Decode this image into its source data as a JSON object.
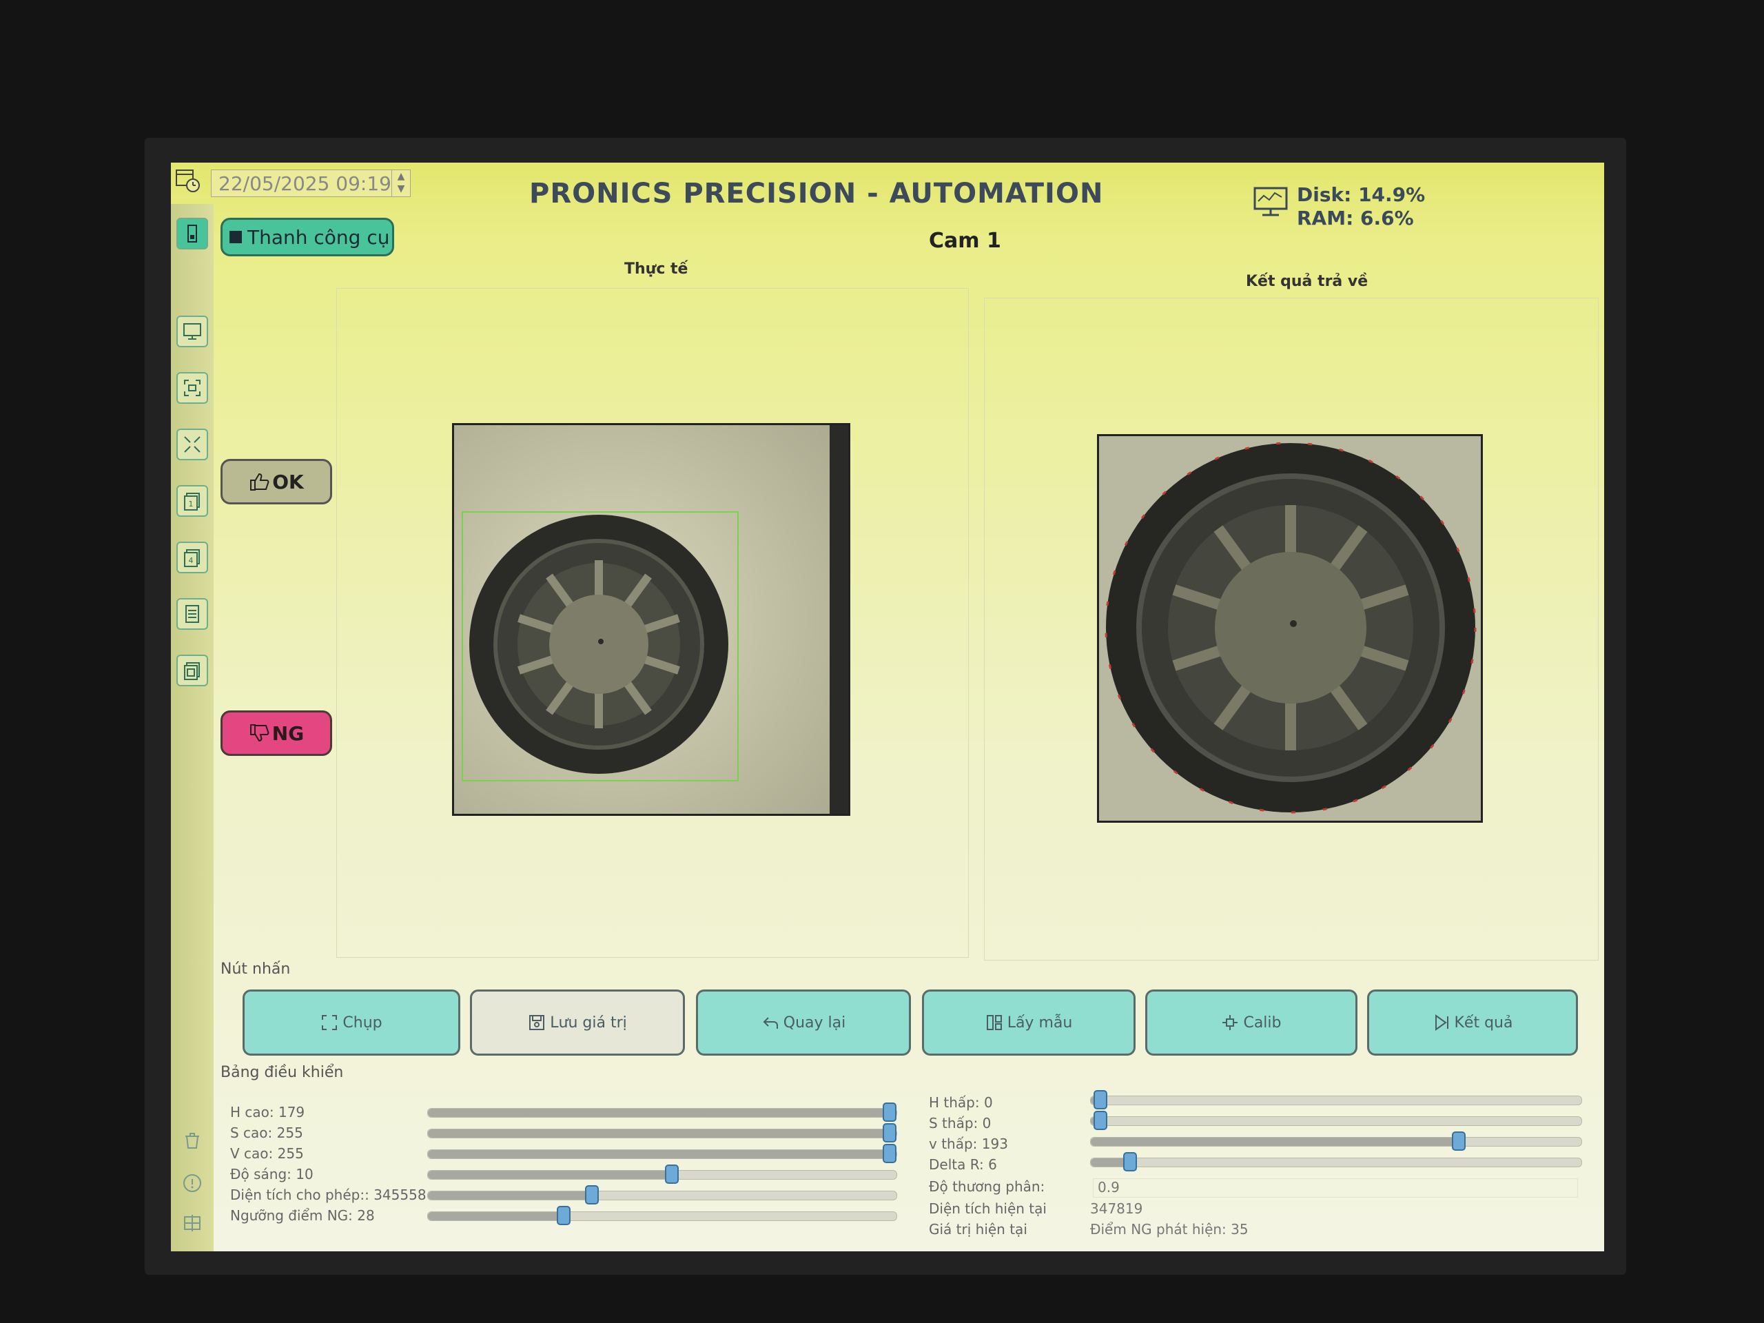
{
  "header": {
    "datetime": "22/05/2025 09:19",
    "title": "PRONICS PRECISION - AUTOMATION",
    "disk": "Disk: 14.9%",
    "ram": "RAM: 6.6%"
  },
  "toolbar": {
    "label": "Thanh công cụ"
  },
  "camera": {
    "title": "Cam 1"
  },
  "status_buttons": {
    "ok": "OK",
    "ng": "NG"
  },
  "panels": {
    "left_label": "Thực tế",
    "right_label": "Kết quả trả về"
  },
  "buttons_section": {
    "label": "Nút nhấn",
    "buttons": [
      {
        "label": "Chụp",
        "icon": "capture-icon"
      },
      {
        "label": "Lưu giá trị",
        "icon": "save-icon"
      },
      {
        "label": "Quay lại",
        "icon": "back-icon"
      },
      {
        "label": "Lấy mẫu",
        "icon": "sample-icon"
      },
      {
        "label": "Calib",
        "icon": "calib-icon"
      },
      {
        "label": "Kết quả",
        "icon": "result-icon"
      }
    ]
  },
  "control_panel": {
    "label": "Bảng điều khiển",
    "left_sliders": [
      {
        "label": "H cao: 179",
        "fraction": 1.0
      },
      {
        "label": "S cao: 255",
        "fraction": 1.0
      },
      {
        "label": "V cao: 255",
        "fraction": 1.0
      },
      {
        "label": "Độ sáng: 10",
        "fraction": 0.52
      },
      {
        "label": "Diện tích cho phép:: 345558",
        "fraction": 0.35
      },
      {
        "label": "Ngưỡng điểm NG: 28",
        "fraction": 0.29
      }
    ],
    "right_sliders": [
      {
        "label": "H thấp: 0",
        "fraction": 0.02
      },
      {
        "label": "S thấp: 0",
        "fraction": 0.02
      },
      {
        "label": "v thấp: 193",
        "fraction": 0.75
      },
      {
        "label": "Delta R: 6",
        "fraction": 0.08
      }
    ],
    "right_values": [
      {
        "label": "Độ thương phân:",
        "value": "0.9"
      },
      {
        "label": "Diện tích hiện tại",
        "value": "347819"
      },
      {
        "label": "Giá trị hiện tại",
        "value": "Điểm NG phát hiện: 35"
      }
    ]
  },
  "colors": {
    "accent_green": "#49c49a",
    "ng_pink": "#e44681",
    "action_teal": "#8fded0",
    "slider_blue": "#6eaad8"
  }
}
